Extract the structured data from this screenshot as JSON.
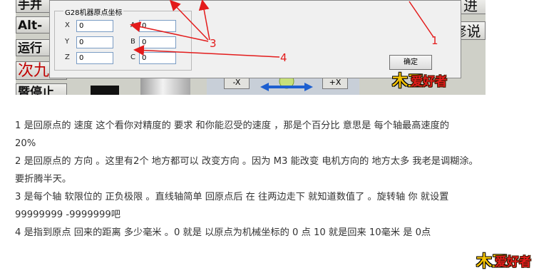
{
  "screenshot": {
    "left_buttons": [
      "手并",
      "Alt-",
      "运行",
      "次九",
      "暨停止"
    ],
    "right_buttons": [
      "进",
      "修说"
    ],
    "dialog": {
      "group_title": "G28机器原点坐标",
      "axes": [
        {
          "label": "X",
          "value": "0"
        },
        {
          "label": "A",
          "value": "0"
        },
        {
          "label": "Y",
          "value": "0"
        },
        {
          "label": "B",
          "value": "0"
        },
        {
          "label": "Z",
          "value": "0"
        },
        {
          "label": "C",
          "value": "0"
        }
      ],
      "ok_label": "确定"
    },
    "annotations": [
      "3",
      "1",
      "4"
    ],
    "jog_buttons": [
      "-X",
      "+X"
    ],
    "logo": {
      "big": "木工",
      "small": "爱好者"
    },
    "colors": {
      "arrow": "#e31b1b",
      "panel": "#cfd0c8",
      "dialog": "#f0f0f0"
    }
  },
  "article": {
    "lines": [
      "1 是回原点的 速度 这个看你对精度的 要求  和你能忍受的速度  ，那是个百分比  意思是 每个轴最高速度的",
      "20%",
      "2 是回原点的 方向 。这里有2个 地方都可以 改变方向 。因为 M3 能改变 电机方向的 地方太多 我老是调糊涂。",
      "要折腾半天。",
      "3 是每个轴 软限位的 正负极限 。直线轴简单  回原点后 在 往两边走下  就知道数值了 。旋转轴 你 就设置",
      "99999999 -9999999吧",
      "4 是指到原点 回来的距离 多少毫米 。0 就是 以原点为机械坐标的 0 点   10 就是回来 10毫米 是 0点"
    ]
  },
  "watermark": {
    "big": "木工",
    "small": "爱好者"
  }
}
